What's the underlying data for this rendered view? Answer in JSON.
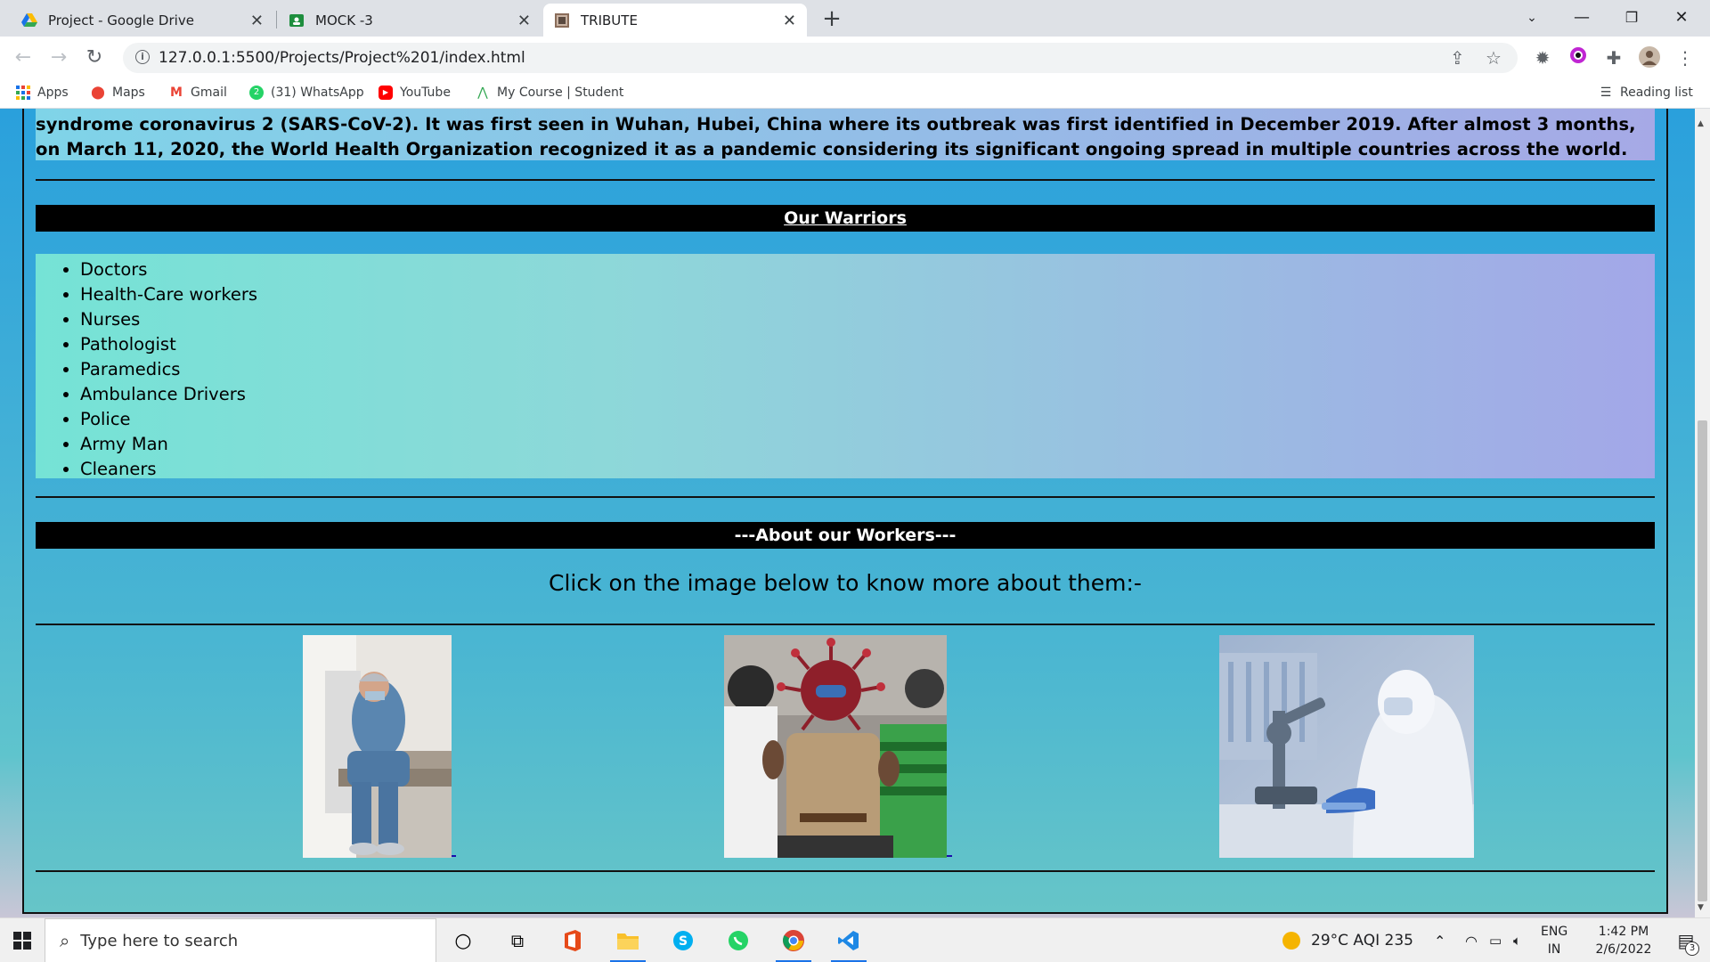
{
  "browser": {
    "tabs": [
      {
        "title": "Project - Google Drive",
        "icon": "google-drive-icon"
      },
      {
        "title": "MOCK -3",
        "icon": "google-classroom-icon"
      },
      {
        "title": "TRIBUTE",
        "icon": "page-favicon-icon"
      }
    ],
    "url": "127.0.0.1:5500/Projects/Project%201/index.html",
    "bookmarks": [
      "Apps",
      "Maps",
      "Gmail",
      "(31) WhatsApp",
      "YouTube",
      "My Course | Student"
    ],
    "reading_list": "Reading list"
  },
  "page": {
    "intro_text": "syndrome coronavirus 2 (SARS-CoV-2). It was first seen in Wuhan, Hubei, China where its outbreak was first identified in December 2019. After almost 3 months, on March 11, 2020, the World Health Organization recognized it as a pandemic considering its significant ongoing spread in multiple countries across the world.",
    "warriors_heading": "Our Warriors",
    "warriors": [
      "Doctors",
      "Health-Care workers",
      "Nurses",
      "Pathologist",
      "Paramedics",
      "Ambulance Drivers",
      "Police",
      "Army Man",
      "Cleaners"
    ],
    "workers_heading": "---About our Workers---",
    "click_text": "Click on the image below to know more about them:-"
  },
  "taskbar": {
    "search_placeholder": "Type here to search",
    "weather": "29°C  AQI 235",
    "lang_top": "ENG",
    "lang_bottom": "IN",
    "time": "1:42 PM",
    "date": "2/6/2022",
    "notifications": "3"
  },
  "colors": {
    "accent": "#1a73e8",
    "page_bg": "#2aa1dc",
    "heading_bg": "#000000"
  }
}
